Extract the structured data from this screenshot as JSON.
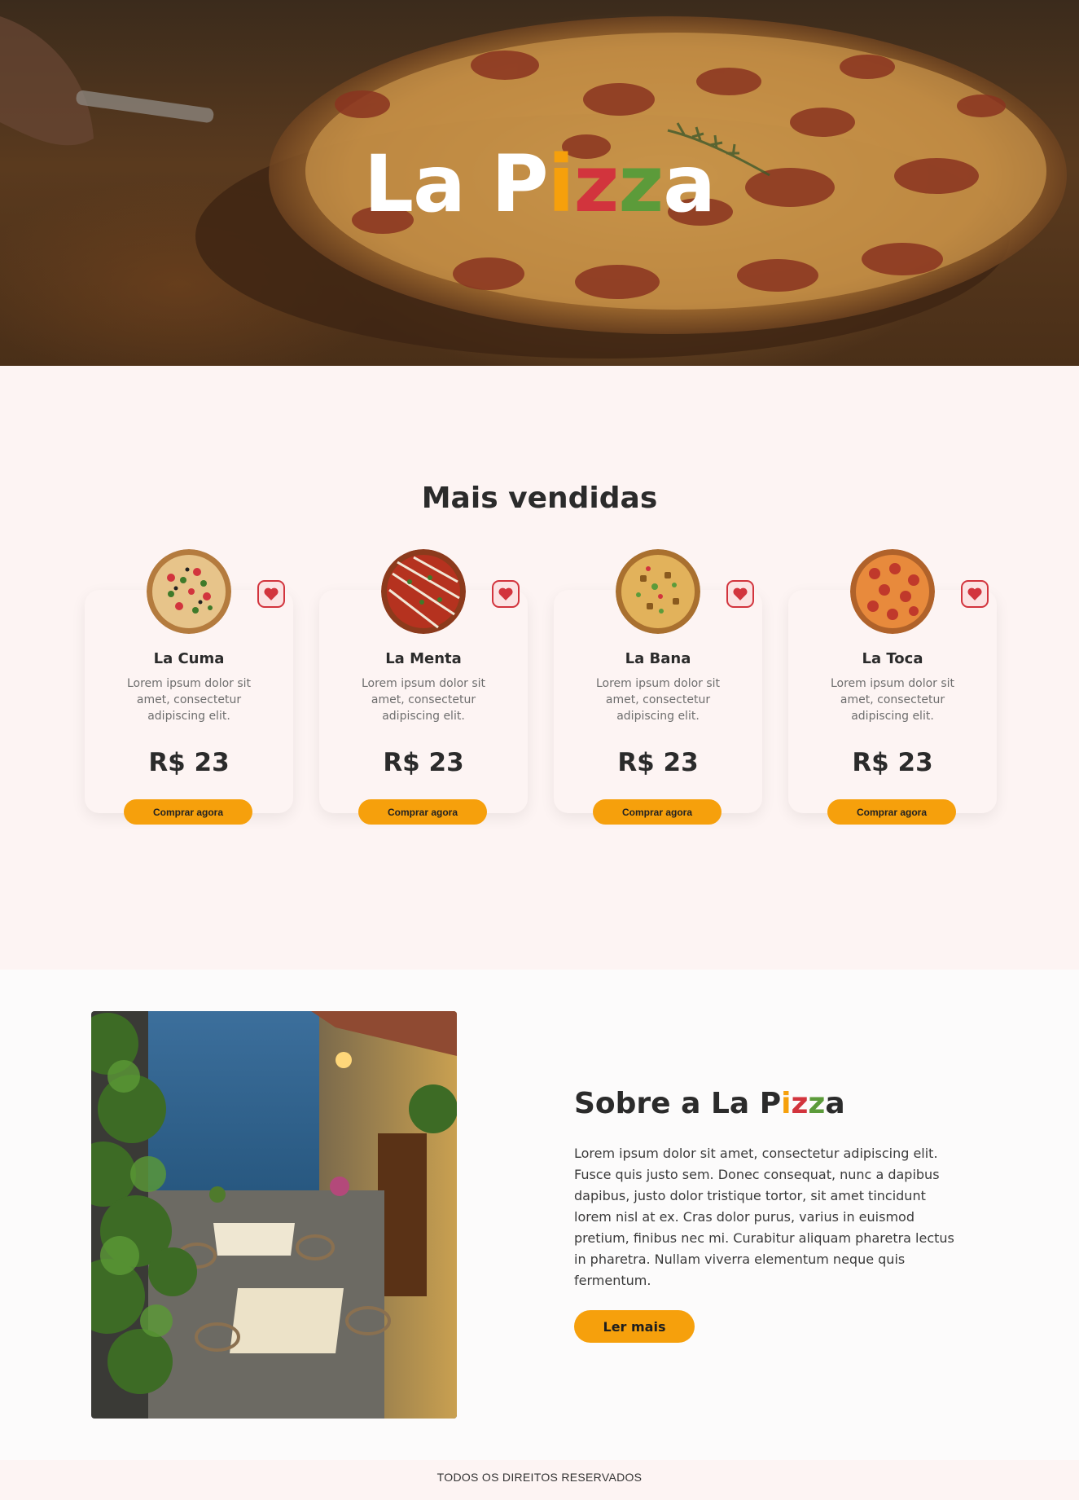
{
  "hero": {
    "title_parts": [
      "La P",
      "i",
      "z",
      "z",
      "a"
    ]
  },
  "bestsellers": {
    "title": "Mais vendidas",
    "products": [
      {
        "name": "La Cuma",
        "description": "Lorem ipsum dolor sit amet, consectetur adipiscing elit.",
        "price": "R$ 23",
        "button": "Comprar agora"
      },
      {
        "name": "La Menta",
        "description": "Lorem ipsum dolor sit amet, consectetur adipiscing elit.",
        "price": "R$ 23",
        "button": "Comprar agora"
      },
      {
        "name": "La Bana",
        "description": "Lorem ipsum dolor sit amet, consectetur adipiscing elit.",
        "price": "R$ 23",
        "button": "Comprar agora"
      },
      {
        "name": "La Toca",
        "description": "Lorem ipsum dolor sit amet, consectetur adipiscing elit.",
        "price": "R$ 23",
        "button": "Comprar agora"
      }
    ]
  },
  "about": {
    "title_prefix": "Sobre a ",
    "title_parts": [
      "La P",
      "i",
      "z",
      "z",
      "a"
    ],
    "text": "Lorem ipsum dolor sit amet, consectetur adipiscing elit. Fusce quis justo sem. Donec consequat, nunc a dapibus dapibus, justo dolor tristique tortor, sit amet tincidunt lorem nisl at ex. Cras dolor purus, varius in euismod pretium, finibus nec mi. Curabitur aliquam pharetra lectus in pharetra. Nullam viverra elementum neque quis fermentum.",
    "button": "Ler mais"
  },
  "footer": {
    "text": "TODOS OS DIREITOS RESERVADOS"
  },
  "colors": {
    "accent": "#f6a00c",
    "red": "#d2343d",
    "green": "#5c9b3a",
    "section_bg": "#fdf4f3"
  },
  "icons": {
    "favorite": "heart-icon"
  }
}
